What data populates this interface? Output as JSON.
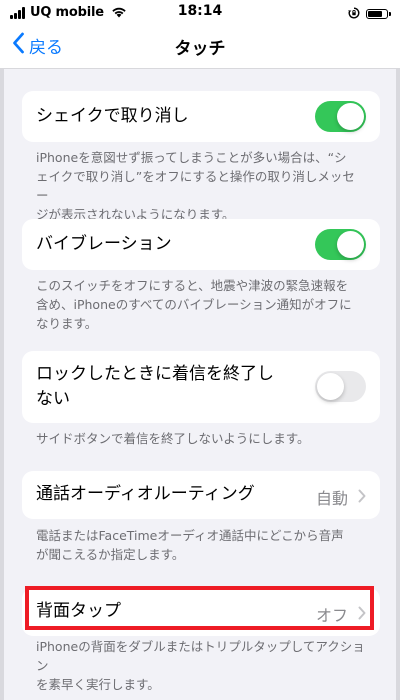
{
  "status_bar": {
    "carrier": "UQ mobile",
    "time": "18:14",
    "battery_level": 0.85
  },
  "nav": {
    "back_label": "戻る",
    "title": "タッチ"
  },
  "settings": {
    "shake_to_undo": {
      "label": "シェイクで取り消し",
      "enabled": true,
      "footer_line1": "iPhoneを意図せず振ってしまうことが多い場合は、“シ",
      "footer_line2": "ェイクで取り消し”をオフにすると操作の取り消しメッセー",
      "footer_line3": "ジが表示されないようになります。"
    },
    "vibration": {
      "label": "バイブレーション",
      "enabled": true,
      "footer_line1": "このスイッチをオフにすると、地震や津波の緊急速報を",
      "footer_line2": "含め、iPhoneのすべてのバイブレーション通知がオフに",
      "footer_line3": "なります。"
    },
    "lock_to_end_call": {
      "label_line1": "ロックしたときに着信を終了し",
      "label_line2": "ない",
      "enabled": false,
      "footer_line1": "サイドボタンで着信を終了しないようにします。"
    },
    "call_audio_routing": {
      "label": "通話オーディオルーティング",
      "value": "自動",
      "footer_line1": "電話またはFaceTimeオーディオ通話中にどこから音声",
      "footer_line2": "が聞こえるか指定します。"
    },
    "back_tap": {
      "label": "背面タップ",
      "value": "オフ",
      "footer_line1": "iPhoneの背面をダブルまたはトリプルタップしてアクション",
      "footer_line2": "を素早く実行します。"
    }
  },
  "colors": {
    "toggle_on": "#34c759",
    "toggle_off": "#e9e9eb",
    "accent": "#0a7aff",
    "highlight": "#ee1c25"
  }
}
